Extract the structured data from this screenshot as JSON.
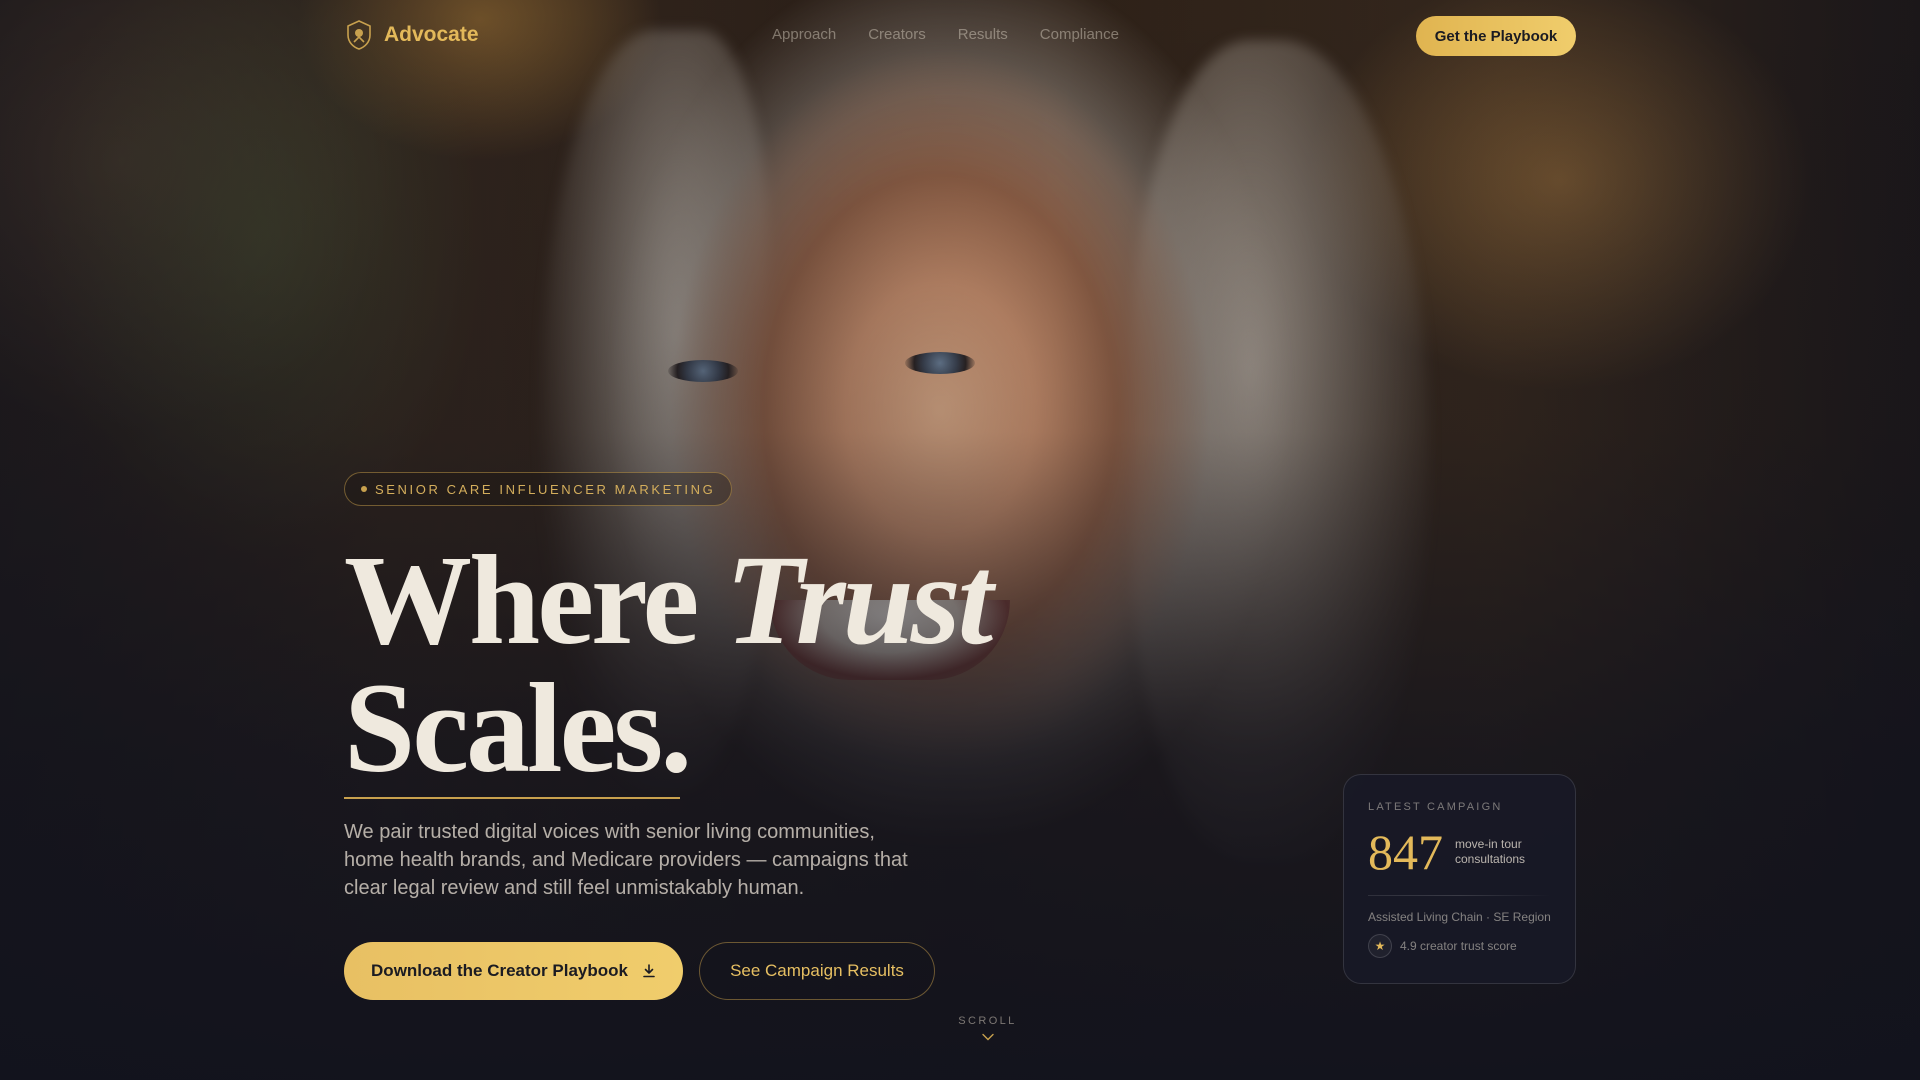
{
  "nav": {
    "brand": "Advocate",
    "links": [
      "Approach",
      "Creators",
      "Results",
      "Compliance"
    ],
    "cta": "Get the Playbook"
  },
  "hero": {
    "badge": "SENIOR CARE INFLUENCER MARKETING",
    "headline_part1": "Where ",
    "headline_emphasis": "Trust",
    "headline_line2": "Scales.",
    "lead": "We pair trusted digital voices with senior living communities, home health brands, and Medicare providers — campaigns that clear legal review and still feel unmistakably human.",
    "primary_cta": "Download the Creator Playbook",
    "secondary_cta": "See Campaign Results",
    "scroll_label": "SCROLL"
  },
  "campaign_card": {
    "label": "LATEST CAMPAIGN",
    "number": "847",
    "caption": "move-in tour consultations",
    "client": "Assisted Living Chain · SE Region",
    "score": "4.9 creator trust score"
  },
  "colors": {
    "accent_gold": "#e3b95a",
    "background": "#12131d",
    "text_light": "#efe9de"
  },
  "icons": {
    "logo": "shield-crest-icon",
    "download": "download-icon",
    "scroll": "chevron-down-icon",
    "rating": "star-icon"
  }
}
